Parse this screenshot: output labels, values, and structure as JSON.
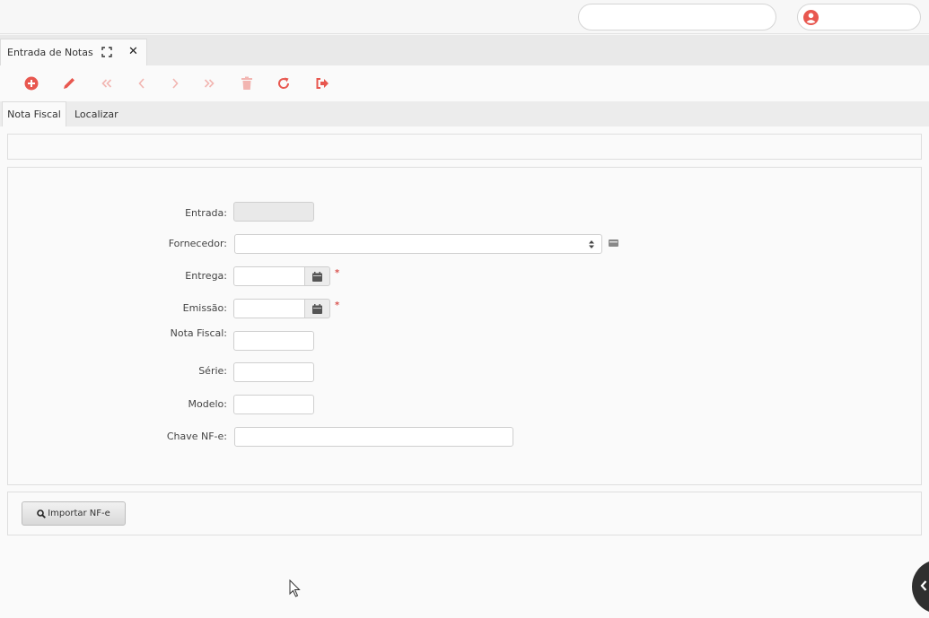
{
  "topbar": {
    "search_value": "",
    "user_name": ""
  },
  "tab": {
    "title": "Entrada de Notas"
  },
  "subtabs": [
    "Nota Fiscal",
    "Localizar"
  ],
  "form": {
    "entrada_label": "Entrada:",
    "fornecedor_label": "Fornecedor:",
    "entrega_label": "Entrega:",
    "emissao_label": "Emissão:",
    "nota_fiscal_label": "Nota Fiscal:",
    "serie_label": "Série:",
    "modelo_label": "Modelo:",
    "chave_label": "Chave NF-e:",
    "required_mark": "*"
  },
  "actions": {
    "import_label": "Importar NF-e"
  },
  "colors": {
    "accent": "#e8574f",
    "disabled_icon": "#f2b5b1"
  }
}
